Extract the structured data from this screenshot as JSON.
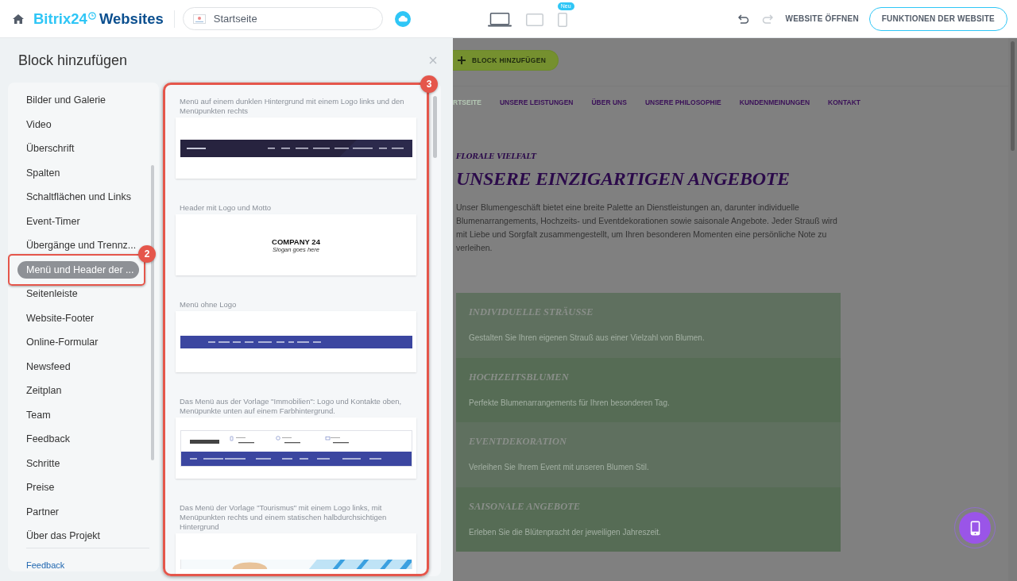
{
  "top_bar": {
    "logo": {
      "brand": "Bitrix24",
      "product": "Websites"
    },
    "page_select": {
      "value": "Startseite"
    },
    "devices": [
      {
        "kind": "laptop",
        "selected": true
      },
      {
        "kind": "tablet",
        "selected": false
      },
      {
        "kind": "phone",
        "selected": false,
        "badge": "Neu"
      }
    ],
    "undo": {
      "disabled": false
    },
    "redo": {
      "disabled": true
    },
    "open_link": "WEBSITE ÖFFNEN",
    "features_button": "FUNKTIONEN DER WEBSITE"
  },
  "panel": {
    "title": "Block hinzufügen",
    "feedback_link": "Feedback",
    "categories": [
      {
        "label": "Bilder und Galerie",
        "selected": false
      },
      {
        "label": "Video",
        "selected": false
      },
      {
        "label": "Überschrift",
        "selected": false
      },
      {
        "label": "Spalten",
        "selected": false
      },
      {
        "label": "Schaltflächen und Links",
        "selected": false
      },
      {
        "label": "Event-Timer",
        "selected": false
      },
      {
        "label": "Übergänge und Trennz...",
        "selected": false
      },
      {
        "label": "Menü und Header der ...",
        "selected": true,
        "callout": "2"
      },
      {
        "label": "Seitenleiste",
        "selected": false
      },
      {
        "label": "Website-Footer",
        "selected": false
      },
      {
        "label": "Online-Formular",
        "selected": false
      },
      {
        "label": "Newsfeed",
        "selected": false
      },
      {
        "label": "Zeitplan",
        "selected": false
      },
      {
        "label": "Team",
        "selected": false
      },
      {
        "label": "Feedback",
        "selected": false
      },
      {
        "label": "Schritte",
        "selected": false
      },
      {
        "label": "Preise",
        "selected": false
      },
      {
        "label": "Partner",
        "selected": false
      },
      {
        "label": "Über das Projekt",
        "selected": false
      }
    ],
    "blocks_callout": "3",
    "blocks": [
      {
        "description": "Menü auf einem dunklen Hintergrund mit einem Logo links und den Menüpunkten rechts",
        "preview": {
          "kind": "dark-menu"
        }
      },
      {
        "description": "Header mit Logo und Motto",
        "preview": {
          "kind": "logo-slogan",
          "logo": "COMPANY 24",
          "slogan": "Slogan goes here"
        }
      },
      {
        "description": "Menü ohne Logo",
        "preview": {
          "kind": "menu-bar"
        }
      },
      {
        "description": "Das Menü aus der Vorlage \"Immobilien\": Logo und Kontakte oben, Menüpunkte unten auf einem Farbhintergrund.",
        "preview": {
          "kind": "contact-header"
        }
      },
      {
        "description": "Das Menü der Vorlage \"Tourismus\" mit einem Logo links, mit Menüpunkten rechts und einem statischen halbdurchsichtigen Hintergrund",
        "preview": {
          "kind": "transparent-menu"
        }
      }
    ]
  },
  "page": {
    "add_block_button": "BLOCK HINZUFÜGEN",
    "nav": [
      {
        "label": "RTSEITE",
        "selected": true
      },
      {
        "label": "UNSERE LEISTUNGEN",
        "selected": false
      },
      {
        "label": "ÜBER UNS",
        "selected": false
      },
      {
        "label": "UNSERE PHILOSOPHIE",
        "selected": false
      },
      {
        "label": "KUNDENMEINUNGEN",
        "selected": false
      },
      {
        "label": "KONTAKT",
        "selected": false
      }
    ],
    "eyebrow": "FLORALE VIELFALT",
    "heading": "UNSERE EINZIGARTIGEN ANGEBOTE",
    "intro": "Unser Blumengeschäft bietet eine breite Palette an Dienstleistungen an, darunter individuelle Blumenarrangements, Hochzeits- und Eventdekorationen sowie saisonale Angebote. Jeder Strauß wird mit Liebe und Sorgfalt zusammengestellt, um Ihren besonderen Momenten eine persönliche Note zu verleihen.",
    "offers": [
      {
        "title": "INDIVIDUELLE STRÄUSSE",
        "text": "Gestalten Sie Ihren eigenen Strauß aus einer Vielzahl von Blumen."
      },
      {
        "title": "HOCHZEITSBLUMEN",
        "text": "Perfekte Blumenarrangements für Ihren besonderen Tag."
      },
      {
        "title": "EVENTDEKORATION",
        "text": "Verleihen Sie Ihrem Event mit unseren Blumen Stil."
      },
      {
        "title": "SAISONALE ANGEBOTE",
        "text": "Erleben Sie die Blütenpracht der jeweiligen Jahreszeit."
      }
    ]
  }
}
